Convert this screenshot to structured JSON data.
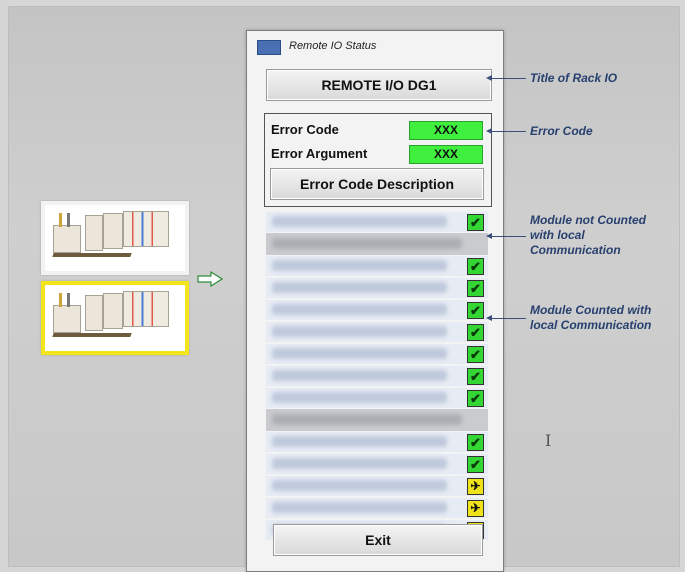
{
  "window": {
    "title": "Remote IO Status"
  },
  "rack": {
    "title_button": "REMOTE I/O DG1"
  },
  "error": {
    "code_label": "Error Code",
    "code_value": "XXX",
    "argument_label": "Error Argument",
    "argument_value": "XXX",
    "description_button": "Error Code Description"
  },
  "exit_button": "Exit",
  "callouts": {
    "rack_title": "Title of Rack IO",
    "error_code": "Error Code",
    "not_counted": "Module not Counted with local Communication",
    "counted": "Module Counted with local Communication"
  },
  "modules": [
    {
      "type": "item",
      "status": "ok"
    },
    {
      "type": "header"
    },
    {
      "type": "item",
      "status": "ok"
    },
    {
      "type": "item",
      "status": "ok"
    },
    {
      "type": "item",
      "status": "ok"
    },
    {
      "type": "item",
      "status": "ok"
    },
    {
      "type": "item",
      "status": "ok"
    },
    {
      "type": "item",
      "status": "ok"
    },
    {
      "type": "item",
      "status": "ok"
    },
    {
      "type": "header"
    },
    {
      "type": "item",
      "status": "ok"
    },
    {
      "type": "item",
      "status": "ok"
    },
    {
      "type": "item",
      "status": "warn"
    },
    {
      "type": "item",
      "status": "warn"
    },
    {
      "type": "item",
      "status": "warn"
    }
  ],
  "icons": {
    "ok": "check-icon",
    "warn": "warning-icon"
  },
  "colors": {
    "ok": "#33d633",
    "warn": "#f0e21a",
    "error_value_bg": "#3ff03f"
  }
}
